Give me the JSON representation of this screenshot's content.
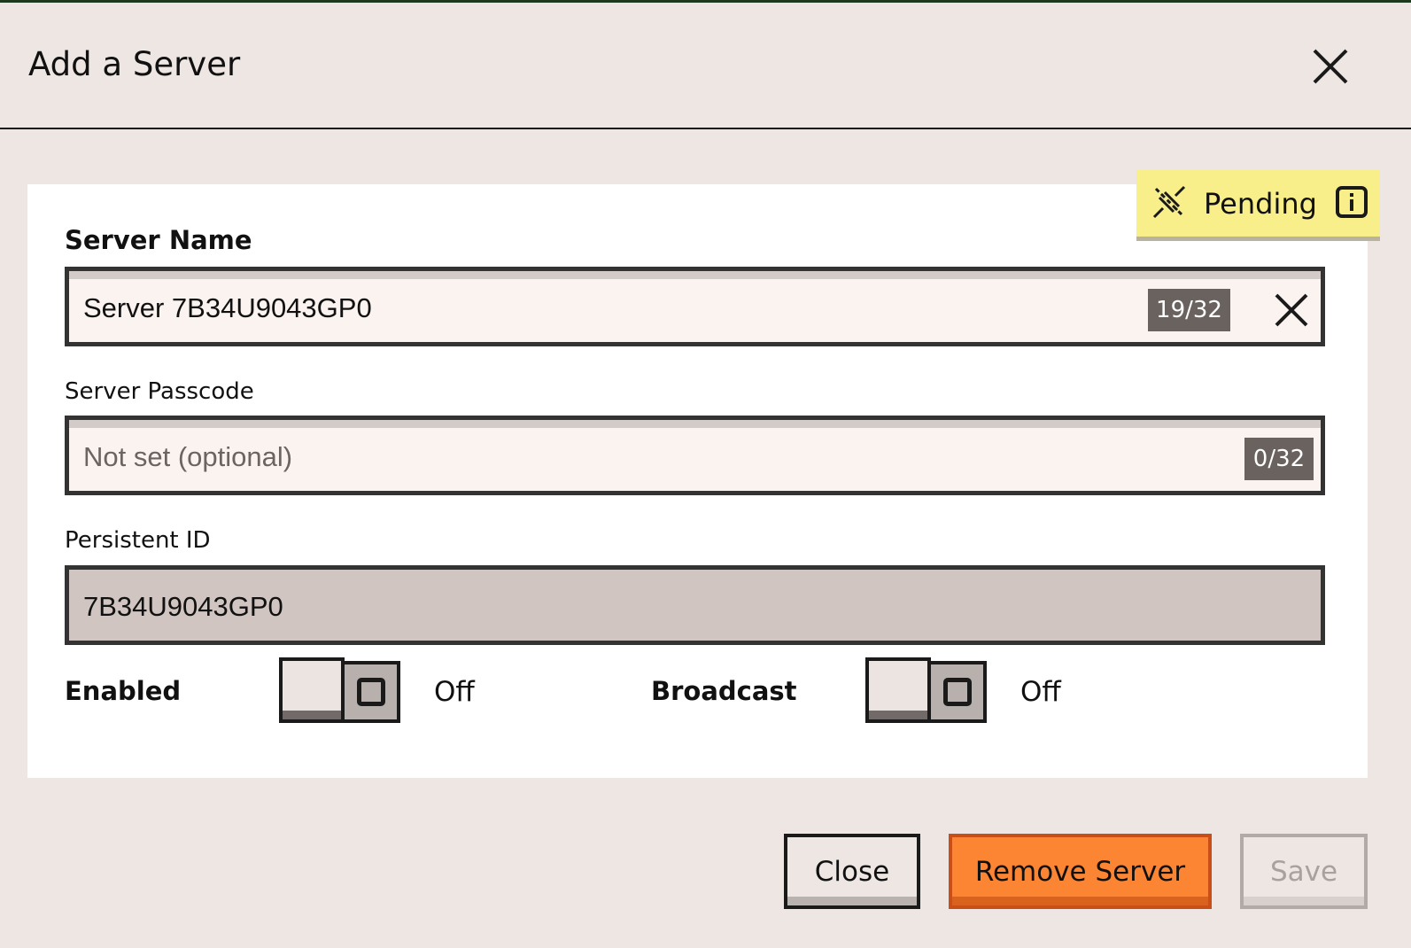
{
  "dialog": {
    "title": "Add a Server",
    "status": {
      "label": "Pending",
      "color": "#f9ef8a",
      "icon": "disconnected-plug-icon",
      "info_icon": "info-icon"
    }
  },
  "fields": {
    "server_name": {
      "label": "Server Name",
      "value": "Server 7B34U9043GP0",
      "counter": "19/32"
    },
    "server_passcode": {
      "label": "Server Passcode",
      "value": "",
      "placeholder": "Not set (optional)",
      "counter": "0/32"
    },
    "persistent_id": {
      "label": "Persistent ID",
      "value": "7B34U9043GP0"
    }
  },
  "toggles": {
    "enabled": {
      "label": "Enabled",
      "state": "Off"
    },
    "broadcast": {
      "label": "Broadcast",
      "state": "Off"
    }
  },
  "buttons": {
    "close": "Close",
    "remove": "Remove Server",
    "save": "Save"
  },
  "colors": {
    "accent": "#fb8532",
    "background": "#ede6e3"
  }
}
